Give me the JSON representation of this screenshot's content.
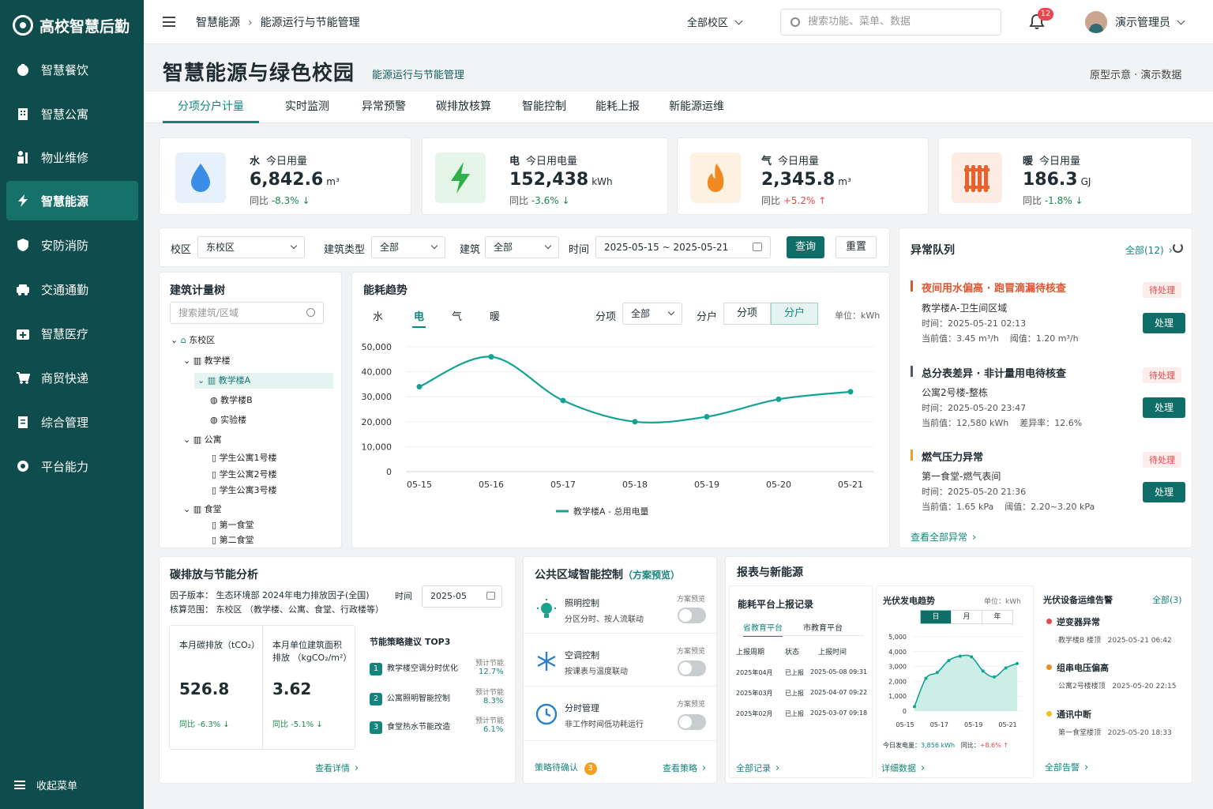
{
  "app": {
    "title": "高校智慧后勤"
  },
  "sidebar": {
    "items": [
      {
        "label": "智慧餐饮"
      },
      {
        "label": "智慧公寓"
      },
      {
        "label": "物业维修"
      },
      {
        "label": "智慧能源"
      },
      {
        "label": "安防消防"
      },
      {
        "label": "交通通勤"
      },
      {
        "label": "智慧医疗"
      },
      {
        "label": "商贸快递"
      },
      {
        "label": "综合管理"
      },
      {
        "label": "平台能力"
      }
    ],
    "collapse": "收起菜单"
  },
  "header": {
    "crumb1": "智慧能源",
    "crumb2": "能源运行与节能管理",
    "campus": "全部校区",
    "search_placeholder": "搜索功能、菜单、数据",
    "notif": "12",
    "user": "演示管理员"
  },
  "page": {
    "title": "智慧能源与绿色校园",
    "subtitle": "能源运行与节能管理",
    "note": "原型示意 · 演示数据"
  },
  "tabs": [
    {
      "label": "分项分户计量"
    },
    {
      "label": "实时监测"
    },
    {
      "label": "异常预警"
    },
    {
      "label": "碳排放核算"
    },
    {
      "label": "智能控制"
    },
    {
      "label": "能耗上报"
    },
    {
      "label": "新能源运维"
    }
  ],
  "kpis": [
    {
      "name": "水",
      "label": "今日用量",
      "value": "6,842.6",
      "unit": "m³",
      "yoy_label": "同比",
      "yoy": "-8.3%",
      "arrow": "↓"
    },
    {
      "name": "电",
      "label": "今日用电量",
      "value": "152,438",
      "unit": "kWh",
      "yoy_label": "同比",
      "yoy": "-3.6%",
      "arrow": "↓"
    },
    {
      "name": "气",
      "label": "今日用量",
      "value": "2,345.8",
      "unit": "m³",
      "yoy_label": "同比",
      "yoy": "+5.2%",
      "arrow": "↑"
    },
    {
      "name": "暖",
      "label": "今日用量",
      "value": "186.3",
      "unit": "GJ",
      "yoy_label": "同比",
      "yoy": "-1.8%",
      "arrow": "↓"
    }
  ],
  "filters": {
    "campus_label": "校区",
    "campus": "东校区",
    "type_label": "建筑类型",
    "type": "全部",
    "building_label": "建筑",
    "building": "全部",
    "time_label": "时间",
    "start": "2025-05-15",
    "tilde": "~",
    "end": "2025-05-21",
    "query": "查询",
    "reset": "重置"
  },
  "tree": {
    "title": "建筑计量树",
    "placeholder": "搜索建筑/区域",
    "nodes": [
      "东校区",
      "教学楼",
      "教学楼A",
      "教学楼B",
      "实验楼",
      "公寓",
      "学生公寓1号楼",
      "学生公寓2号楼",
      "学生公寓3号楼",
      "食堂",
      "第一食堂",
      "第二食堂"
    ]
  },
  "trend": {
    "title": "能耗趋势",
    "tabs": [
      "水",
      "电",
      "气",
      "暖"
    ],
    "split_label": "分项",
    "split": "全部",
    "mode_label": "分户",
    "mode_a": "分项",
    "mode_b": "分户",
    "unit": "单位：kWh"
  },
  "chart_data": {
    "type": "line",
    "categories": [
      "05-15",
      "05-16",
      "05-17",
      "05-18",
      "05-19",
      "05-20",
      "05-21"
    ],
    "series": [
      {
        "name": "教学楼A - 总用电量",
        "values": [
          34000,
          46000,
          28500,
          20000,
          22000,
          29000,
          32000
        ]
      }
    ],
    "ylim": [
      0,
      50000
    ],
    "yticks": [
      "0",
      "10,000",
      "20,000",
      "30,000",
      "40,000",
      "50,000"
    ],
    "color": "#13a394"
  },
  "alarms": {
    "title": "异常队列",
    "all": "全部(12)",
    "status": "待处理",
    "handle": "处理",
    "more": "查看全部异常",
    "items": [
      {
        "title": "夜间用水偏高 · 跑冒滴漏待核查",
        "loc": "教学楼A-卫生间区域",
        "time": "时间：2025-05-21 02:13",
        "cur": "当前值：3.45 m³/h",
        "ref": "阈值：1.20 m³/h",
        "color": "#e0552d"
      },
      {
        "title": "总分表差异 · 非计量用电待核查",
        "loc": "公寓2号楼-整栋",
        "time": "时间：2025-05-20 23:47",
        "cur": "当前值：12,580 kWh",
        "ref": "差异率：12.6%",
        "color": "#4a5a62"
      },
      {
        "title": "燃气压力异常",
        "loc": "第一食堂-燃气表间",
        "time": "时间：2025-05-20 21:36",
        "cur": "当前值：1.65 kPa",
        "ref": "阈值：2.20~3.20 kPa",
        "color": "#f0a020"
      }
    ]
  },
  "carbon": {
    "title": "碳排放与节能分析",
    "factor": "因子版本：  生态环境部 2024年电力排放因子(全国)",
    "scope": "核算范围：  东校区 （教学楼、公寓、食堂、行政楼等）",
    "time_label": "时间",
    "time": "2025-05",
    "m1_label": "本月碳排放（tCO₂）",
    "m1_value": "526.8",
    "m1_yoy": "同比  -6.3%  ↓",
    "m2_label1": "本月单位建筑面积",
    "m2_label2": "排放 （kgCO₂/m²）",
    "m2_value": "3.62",
    "m2_yoy": "同比  -5.1%  ↓",
    "top_title": "节能策略建议 TOP3",
    "save_label": "预计节能",
    "tops": [
      {
        "name": "教学楼空调分时优化",
        "val": "12.7%"
      },
      {
        "name": "公寓照明智能控制",
        "val": "8.3%"
      },
      {
        "name": "食堂热水节能改造",
        "val": "6.1%"
      }
    ],
    "more": "查看详情"
  },
  "control": {
    "title": "公共区域智能控制",
    "tag": "（方案预览）",
    "preview": "方案预览",
    "items": [
      {
        "name": "照明控制",
        "desc": "分区分时、按人流联动"
      },
      {
        "name": "空调控制",
        "desc": "按课表与温度联动"
      },
      {
        "name": "分时管理",
        "desc": "非工作时间低功耗运行"
      }
    ],
    "pending": "策略待确认",
    "pending_count": "3",
    "more": "查看策略"
  },
  "report": {
    "title": "报表与新能源",
    "sub": "能耗平台上报记录",
    "tab_a": "省教育平台",
    "tab_b": "市教育平台",
    "cols": [
      "上报周期",
      "状态",
      "上报时间"
    ],
    "rows": [
      [
        "2025年04月",
        "已上报",
        "2025-05-08 09:31"
      ],
      [
        "2025年03月",
        "已上报",
        "2025-04-07 09:22"
      ],
      [
        "2025年02月",
        "已上报",
        "2025-03-07 09:18"
      ]
    ],
    "more": "全部记录"
  },
  "pv": {
    "title": "光伏发电趋势",
    "unit": "单位：kWh",
    "seg": [
      "日",
      "月",
      "年"
    ],
    "yticks": [
      "0",
      "1,000",
      "2,000",
      "3,000",
      "4,000",
      "5,000"
    ],
    "xticks": [
      "05-15",
      "05-17",
      "05-19",
      "05-21"
    ],
    "values": [
      300,
      2200,
      2600,
      3400,
      3700,
      3650,
      2700,
      2300,
      2900,
      3200
    ],
    "ylim": [
      0,
      5000
    ],
    "today_label": "今日发电量：",
    "today": "3,856 kWh",
    "yoy_label": "同比：",
    "yoy": "+8.6%  ↑",
    "more": "详细数据"
  },
  "pvalarm": {
    "title": "光伏设备运维告警",
    "all": "全部(3)",
    "items": [
      {
        "name": "逆变器异常",
        "loc": "教学楼B 楼顶",
        "time": "2025-05-21 06:42",
        "color": "#e5484d"
      },
      {
        "name": "组串电压偏高",
        "loc": "公寓2号楼楼顶",
        "time": "2025-05-20 22:15",
        "color": "#f08a20"
      },
      {
        "name": "通讯中断",
        "loc": "第一食堂楼顶",
        "time": "2025-05-20 18:33",
        "color": "#f0c020"
      }
    ],
    "more": "全部告警"
  }
}
